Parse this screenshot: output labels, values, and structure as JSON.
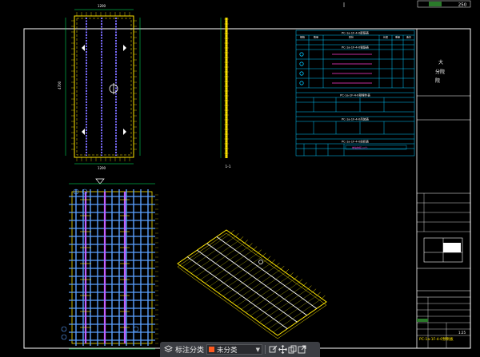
{
  "drawing": {
    "top_right_tag": "250",
    "title_block": {
      "company": [
        "大",
        "分院",
        "院"
      ],
      "sheet_title": "PC-1a-1F-4-0预制板",
      "scale": "1:25"
    },
    "table": {
      "caption_main": "PC-1a-1F-4-0配筋表",
      "caption_sub": "PC-1a-1F-4-0钢筋表",
      "caption_embed": "PC-1a-1F-4-0预埋件表",
      "caption_lift": "PC-1a-1F-4-0吊装表",
      "caption_volume": "PC-1a-1F-4-0体积表",
      "note": "规格·型号"
    },
    "section_label": "1-1"
  },
  "toolbar": {
    "annotate_label": "标注分类",
    "layer_value": "未分类",
    "icons": [
      "layers-icon",
      "edit-icon",
      "move-icon",
      "copy-icon",
      "export-icon"
    ]
  },
  "colors": {
    "frame": "#ffffff",
    "table_line": "#00c8ff",
    "title_accent": "#ffe600",
    "rebar_blue": "#5aa0ff",
    "rebar_purple": "#c060ff",
    "green": "#00ff66",
    "layer_swatch": "#ff5a1f"
  }
}
